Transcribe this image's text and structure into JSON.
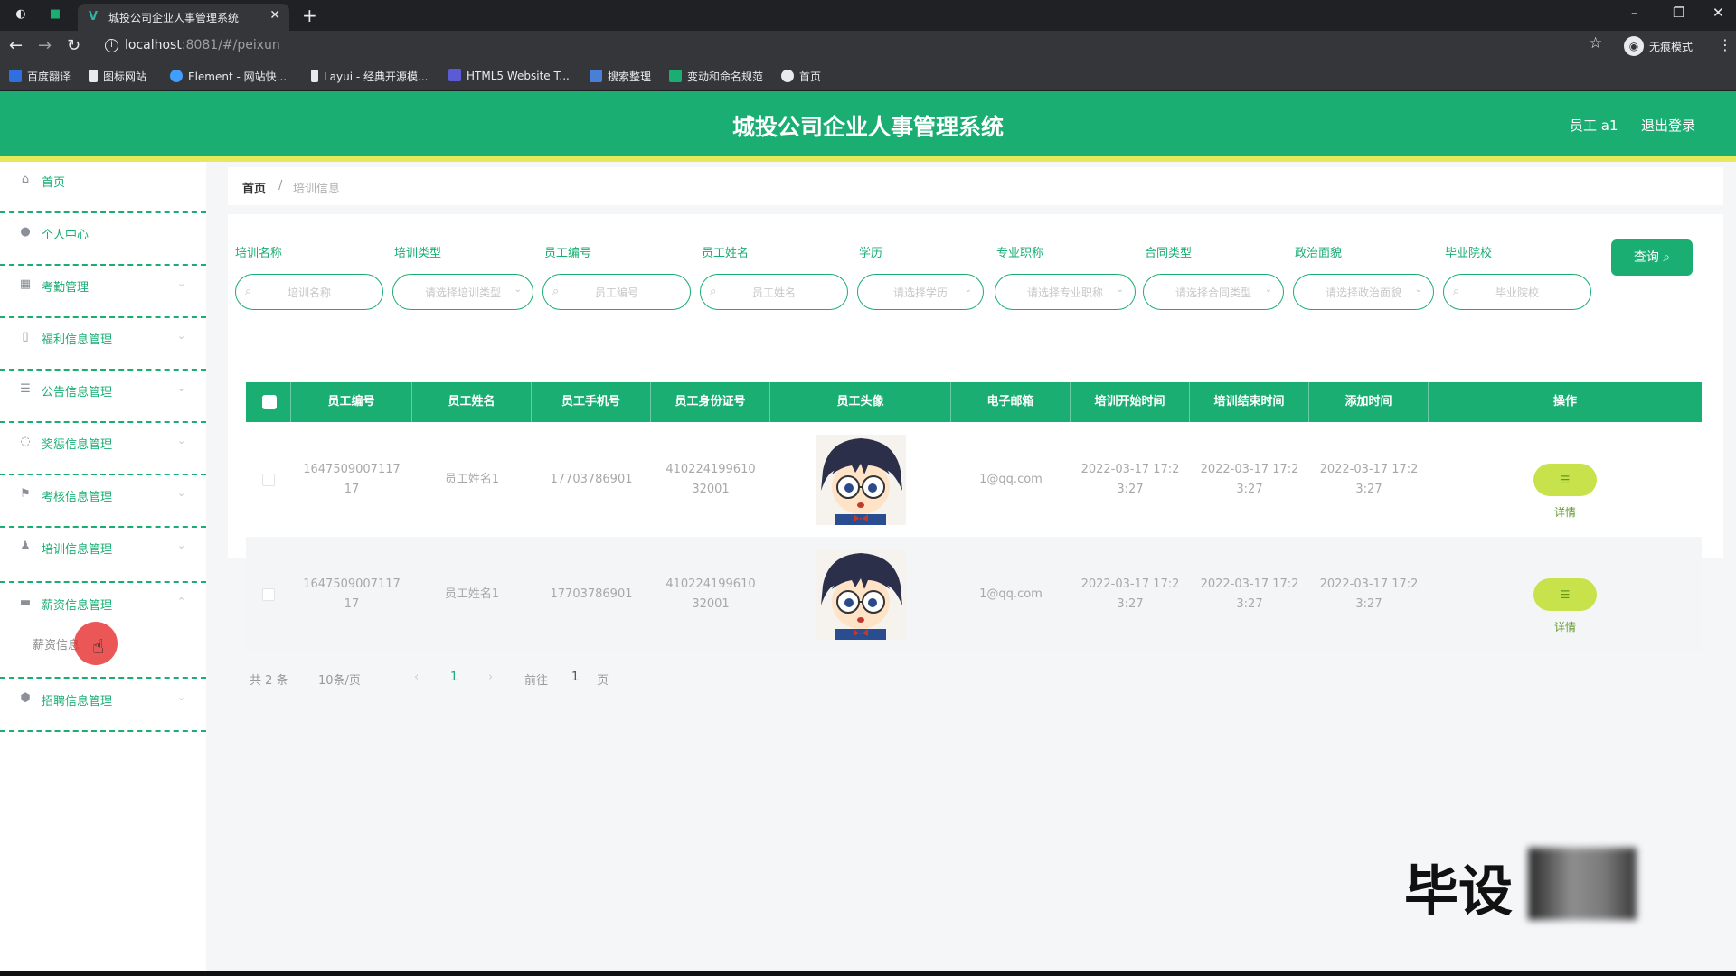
{
  "browser": {
    "tab_title": "城投公司企业人事管理系统",
    "url_host": "localhost",
    "url_rest": ":8081/#/peixun",
    "incognito_label": "无痕模式",
    "bookmarks": [
      {
        "label": "百度翻译",
        "color": "#2f6fdf"
      },
      {
        "label": "图标网站",
        "color": "#e8eaed"
      },
      {
        "label": "Element - 网站快...",
        "color": "#409eff"
      },
      {
        "label": "Layui - 经典开源模...",
        "color": "#e8eaed"
      },
      {
        "label": "HTML5 Website T...",
        "color": "#5b5bd6"
      },
      {
        "label": "搜索整理",
        "color": "#4a7fd8"
      },
      {
        "label": "变动和命名规范",
        "color": "#1aae73"
      },
      {
        "label": "首页",
        "color": "#e8eaed"
      }
    ]
  },
  "header": {
    "title": "城投公司企业人事管理系统",
    "user": "员工 a1",
    "logout": "退出登录",
    "brand_color": "#1aae73",
    "strip_color": "#e7e95a"
  },
  "sidebar": {
    "items": [
      {
        "label": "首页",
        "icon": "home-icon"
      },
      {
        "label": "个人中心",
        "icon": "user-icon"
      },
      {
        "label": "考勤管理",
        "icon": "grid-icon"
      },
      {
        "label": "福利信息管理",
        "icon": "gift-icon"
      },
      {
        "label": "公告信息管理",
        "icon": "list-icon"
      },
      {
        "label": "奖惩信息管理",
        "icon": "message-icon"
      },
      {
        "label": "考核信息管理",
        "icon": "flag-icon"
      },
      {
        "label": "培训信息管理",
        "icon": "person-icon"
      },
      {
        "label": "薪资信息管理",
        "icon": "folder-icon"
      },
      {
        "label": "招聘信息管理",
        "icon": "shield-icon"
      }
    ],
    "submenu_label": "薪资信息"
  },
  "breadcrumb": {
    "home": "首页",
    "sep": "/",
    "current": "培训信息"
  },
  "filters": [
    {
      "label": "培训名称",
      "placeholder": "培训名称",
      "kind": "search"
    },
    {
      "label": "培训类型",
      "placeholder": "请选择培训类型",
      "kind": "select"
    },
    {
      "label": "员工编号",
      "placeholder": "员工编号",
      "kind": "search"
    },
    {
      "label": "员工姓名",
      "placeholder": "员工姓名",
      "kind": "search"
    },
    {
      "label": "学历",
      "placeholder": "请选择学历",
      "kind": "select"
    },
    {
      "label": "专业职称",
      "placeholder": "请选择专业职称",
      "kind": "select"
    },
    {
      "label": "合同类型",
      "placeholder": "请选择合同类型",
      "kind": "select"
    },
    {
      "label": "政治面貌",
      "placeholder": "请选择政治面貌",
      "kind": "select"
    },
    {
      "label": "毕业院校",
      "placeholder": "毕业院校",
      "kind": "search"
    }
  ],
  "query_button": "查询",
  "table": {
    "headers": [
      "员工编号",
      "员工姓名",
      "员工手机号",
      "员工身份证号",
      "员工头像",
      "电子邮箱",
      "培训开始时间",
      "培训结束时间",
      "添加时间",
      "操作"
    ],
    "rows": [
      {
        "employee_no": [
          "1647509007117",
          "17"
        ],
        "name": "员工姓名1",
        "phone": "17703786901",
        "id_card": [
          "410224199610",
          "32001"
        ],
        "email": "1@qq.com",
        "start_time": [
          "2022-03-17 17:2",
          "3:27"
        ],
        "end_time": [
          "2022-03-17 17:2",
          "3:27"
        ],
        "add_time": [
          "2022-03-17 17:2",
          "3:27"
        ],
        "action": "详情"
      },
      {
        "employee_no": [
          "1647509007117",
          "17"
        ],
        "name": "员工姓名1",
        "phone": "17703786901",
        "id_card": [
          "410224199610",
          "32001"
        ],
        "email": "1@qq.com",
        "start_time": [
          "2022-03-17 17:2",
          "3:27"
        ],
        "end_time": [
          "2022-03-17 17:2",
          "3:27"
        ],
        "add_time": [
          "2022-03-17 17:2",
          "3:27"
        ],
        "action": "详情"
      }
    ]
  },
  "pagination": {
    "total": "共 2 条",
    "page_size": "10条/页",
    "prev": "‹",
    "current": "1",
    "next": "›",
    "goto_prefix": "前往",
    "goto_value": "1",
    "goto_suffix": "页"
  },
  "watermark": "毕设"
}
